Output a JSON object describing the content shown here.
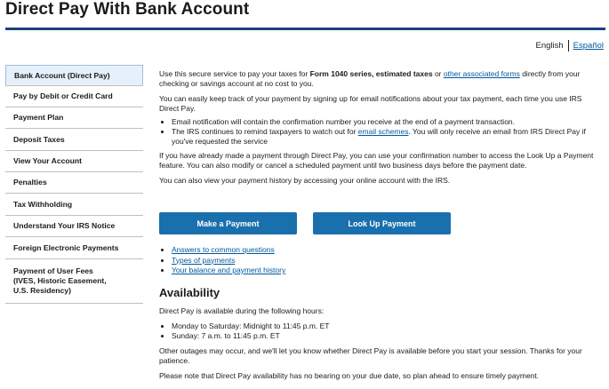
{
  "page": {
    "title": "Direct Pay With Bank Account"
  },
  "language": {
    "english": "English",
    "espanol": "Español"
  },
  "sidebar": {
    "items": [
      {
        "label": "Bank Account (Direct Pay)"
      },
      {
        "label": "Pay by Debit or Credit Card"
      },
      {
        "label": "Payment Plan"
      },
      {
        "label": "Deposit Taxes"
      },
      {
        "label": "View Your Account"
      },
      {
        "label": "Penalties"
      },
      {
        "label": "Tax Withholding"
      },
      {
        "label": "Understand Your IRS Notice"
      },
      {
        "label": "Foreign Electronic Payments"
      },
      {
        "label": "Payment of User Fees (IVES, Historic Easement, U.S. Residency)"
      }
    ]
  },
  "main": {
    "intro_part1": "Use this secure service to pay your taxes for ",
    "intro_bold": "Form 1040 series, estimated taxes",
    "intro_or": " or ",
    "intro_link": "other associated forms",
    "intro_part2": " directly from your checking or savings account at no cost to you.",
    "email_para": "You can easily keep track of your payment by signing up for email notifications about your tax payment, each time you use IRS Direct Pay.",
    "bullet1": "Email notification will contain the confirmation number you receive at the end of a payment transaction.",
    "bullet2_part1": "The IRS continues to remind taxpayers to watch out for ",
    "bullet2_link": "email schemes",
    "bullet2_part2": ". You will only receive an email from IRS Direct Pay if you've requested the service",
    "lookup_para": "If you have already made a payment through Direct Pay, you can use your confirmation number to access the Look Up a Payment feature. You can also modify or cancel a scheduled payment until two business days before the payment date.",
    "history_para": "You can also view your payment history by accessing your online account with the IRS.",
    "make_payment_label": "Make a Payment",
    "lookup_payment_label": "Look Up Payment",
    "links": [
      {
        "label": "Answers to common questions"
      },
      {
        "label": "Types of payments"
      },
      {
        "label": "Your balance and payment history"
      }
    ]
  },
  "availability": {
    "heading": "Availability",
    "intro": "Direct Pay is available during the following hours:",
    "hours": [
      {
        "label": "Monday to Saturday: Midnight to 11:45 p.m. ET"
      },
      {
        "label": "Sunday: 7 a.m. to 11:45 p.m. ET"
      }
    ],
    "outages": "Other outages may occur, and we'll let you know whether Direct Pay is available before you start your session. Thanks for your patience.",
    "note": "Please note that Direct Pay availability has no bearing on your due date, so plan ahead to ensure timely payment."
  },
  "colors": {
    "accent": "#1a4480",
    "button": "#1a6fad",
    "link": "#00599c",
    "sidebar_active_bg": "#e6f0fa"
  }
}
